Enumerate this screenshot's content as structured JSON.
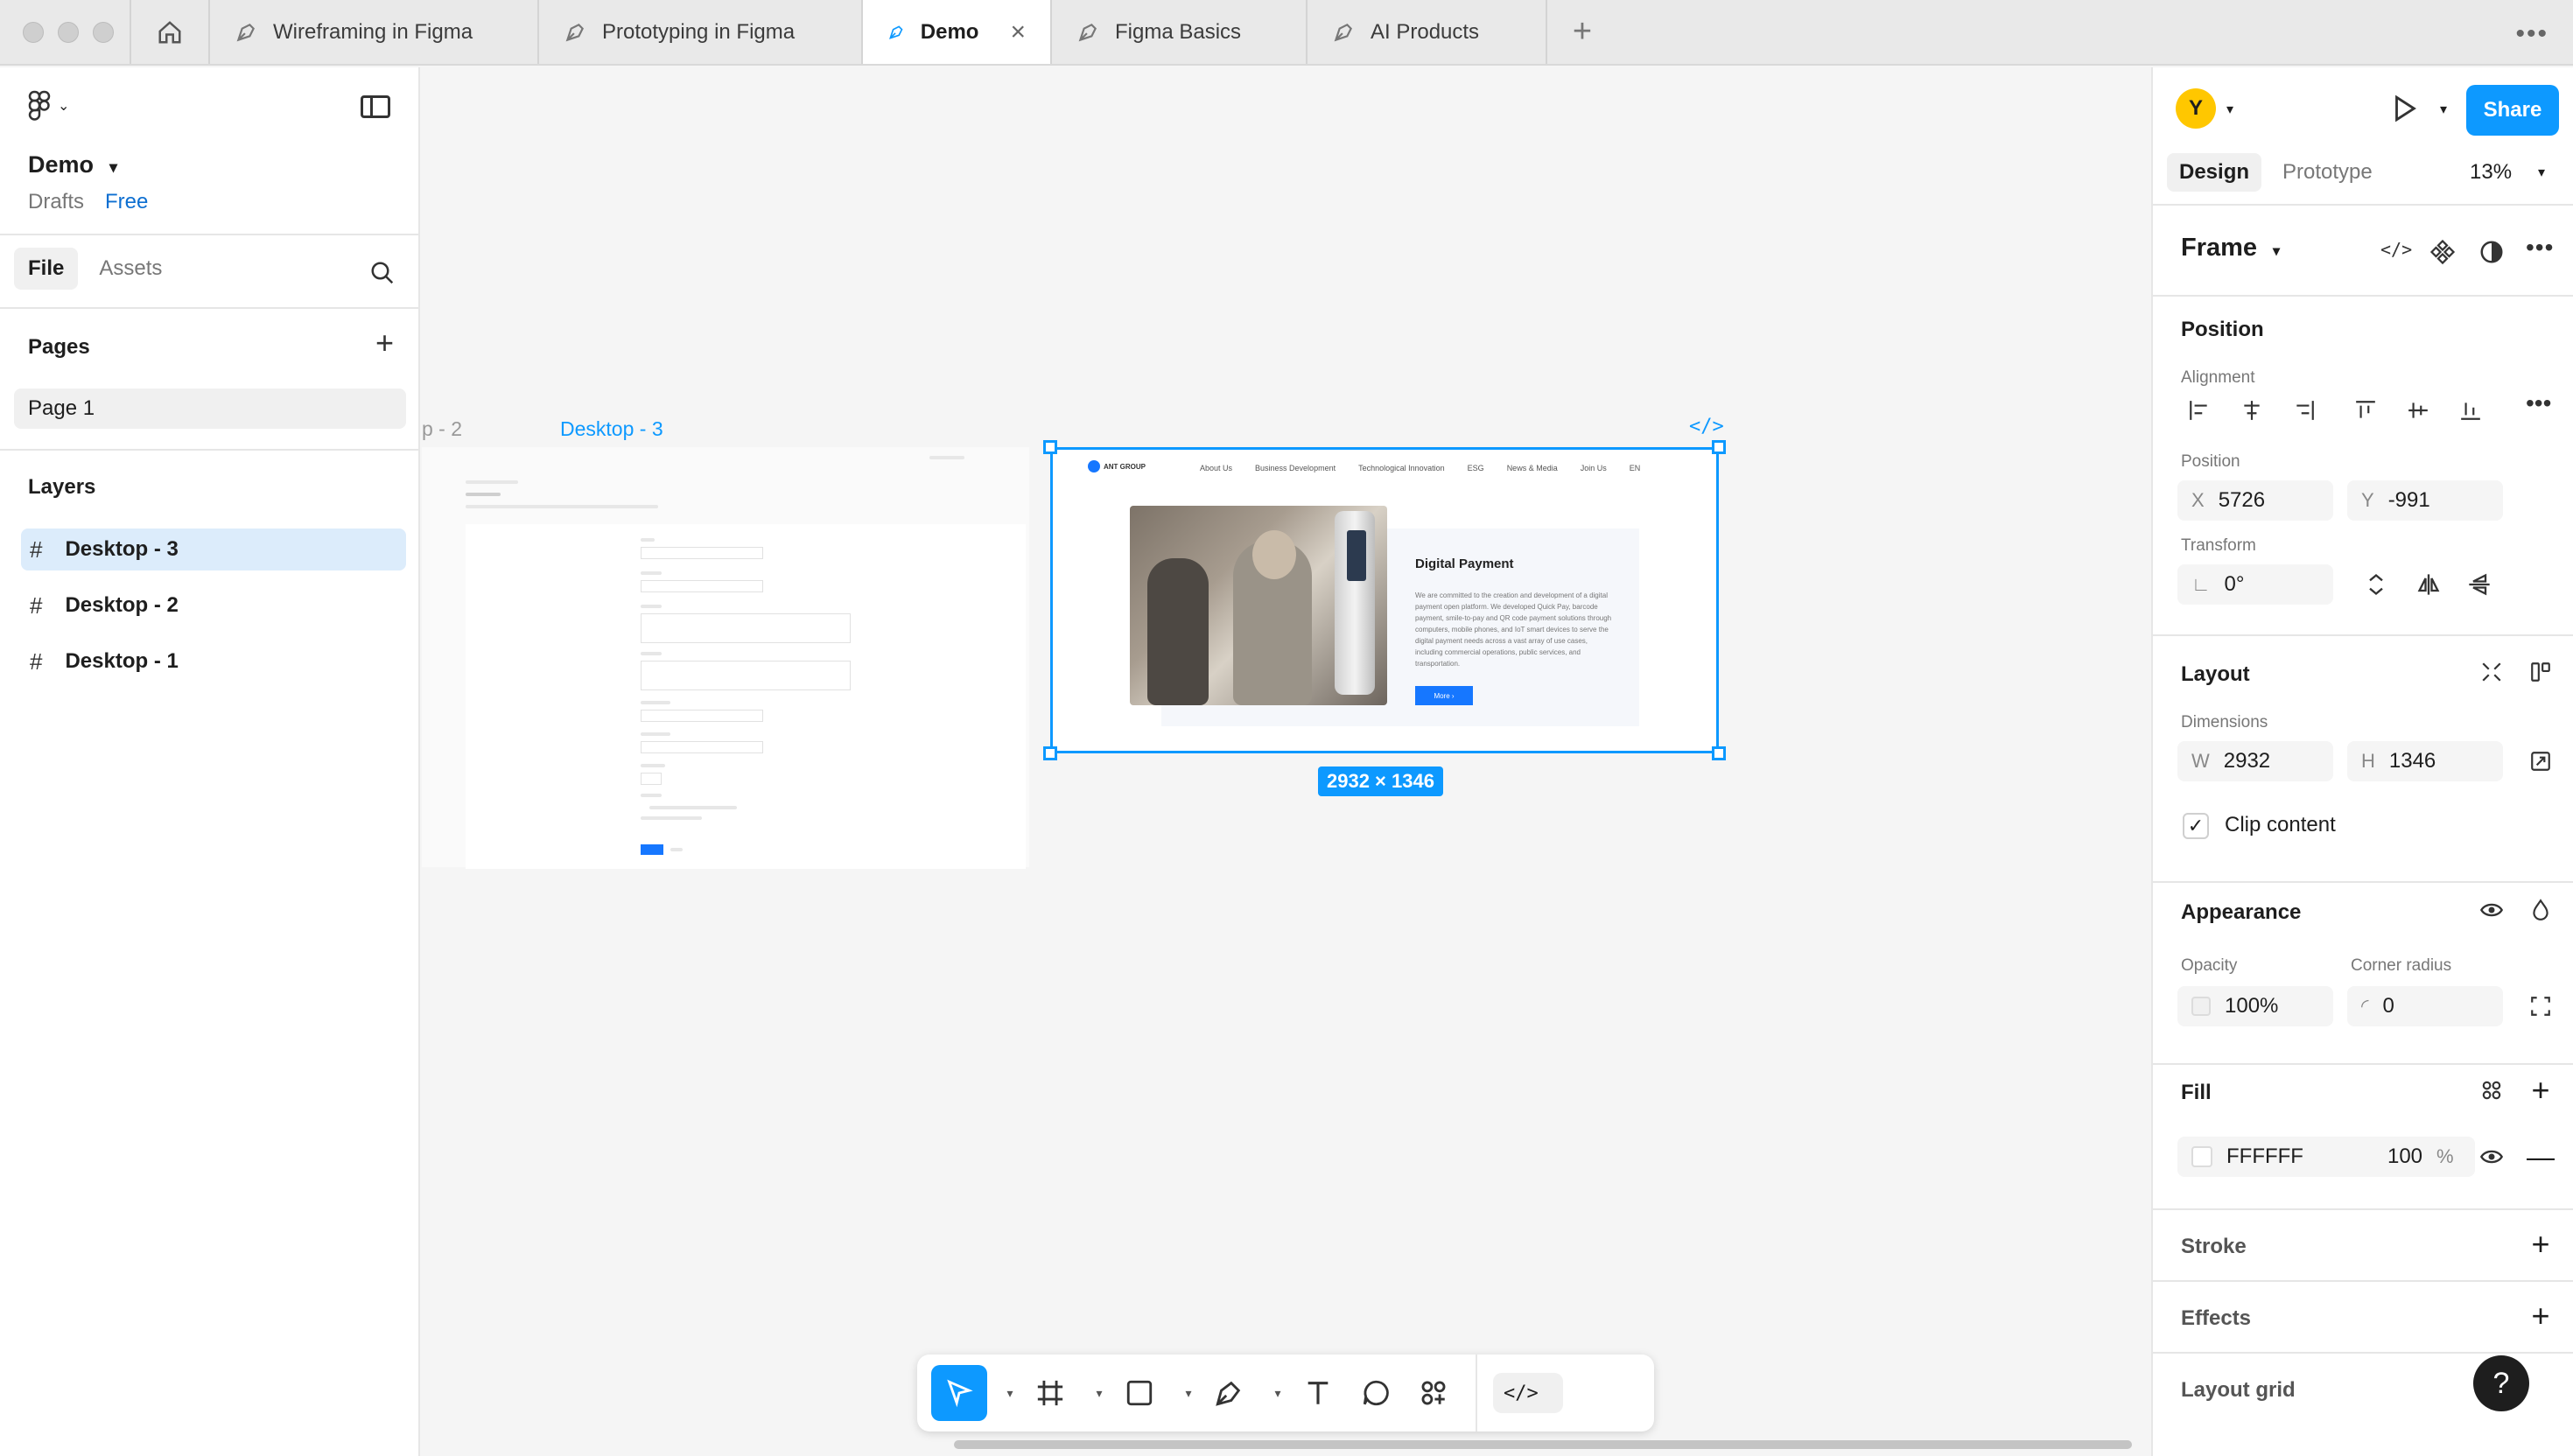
{
  "tabs": [
    {
      "label": "Wireframing in Figma",
      "active": false
    },
    {
      "label": "Prototyping in Figma",
      "active": false
    },
    {
      "label": "Demo",
      "active": true
    },
    {
      "label": "Figma Basics",
      "active": false
    },
    {
      "label": "AI Products",
      "active": false
    }
  ],
  "left": {
    "file_name": "Demo",
    "drafts": "Drafts",
    "plan": "Free",
    "file_tab": "File",
    "assets_tab": "Assets",
    "pages_title": "Pages",
    "page_1": "Page 1",
    "layers_title": "Layers",
    "layers": [
      "Desktop - 3",
      "Desktop - 2",
      "Desktop - 1"
    ]
  },
  "canvas": {
    "d2_label": "p - 2",
    "d3_label": "Desktop - 3",
    "size_badge": "2932 × 1346",
    "d3_nav": [
      "About Us",
      "Business Development",
      "Technological Innovation",
      "ESG",
      "News & Media",
      "Join Us",
      "EN"
    ],
    "d3_logo": "ANT GROUP",
    "d3_heading": "Digital Payment",
    "d3_paragraph": "We are committed to the creation and development of a digital payment open platform. We developed Quick Pay, barcode payment, smile-to-pay and QR code payment solutions through computers, mobile phones, and IoT smart devices to serve the digital payment needs across a vast array of use cases, including commercial operations, public services, and transportation.",
    "d3_more": "More ›"
  },
  "right": {
    "avatar_letter": "Y",
    "share": "Share",
    "design_tab": "Design",
    "prototype_tab": "Prototype",
    "zoom": "13%",
    "frame_title": "Frame",
    "position_title": "Position",
    "alignment_label": "Alignment",
    "position_label": "Position",
    "x_label": "X",
    "x_value": "5726",
    "y_label": "Y",
    "y_value": "-991",
    "transform_label": "Transform",
    "rotation": "0°",
    "layout_title": "Layout",
    "dimensions_label": "Dimensions",
    "w_label": "W",
    "w_value": "2932",
    "h_label": "H",
    "h_value": "1346",
    "clip_content": "Clip content",
    "appearance_title": "Appearance",
    "opacity_label": "Opacity",
    "opacity_value": "100%",
    "corner_label": "Corner radius",
    "corner_value": "0",
    "fill_title": "Fill",
    "fill_hex": "FFFFFF",
    "fill_opacity": "100",
    "fill_pct": "%",
    "stroke_title": "Stroke",
    "effects_title": "Effects",
    "layout_grid_title": "Layout grid",
    "help": "?"
  },
  "colors": {
    "accent": "#0d99ff",
    "avatar": "#ffc700"
  }
}
